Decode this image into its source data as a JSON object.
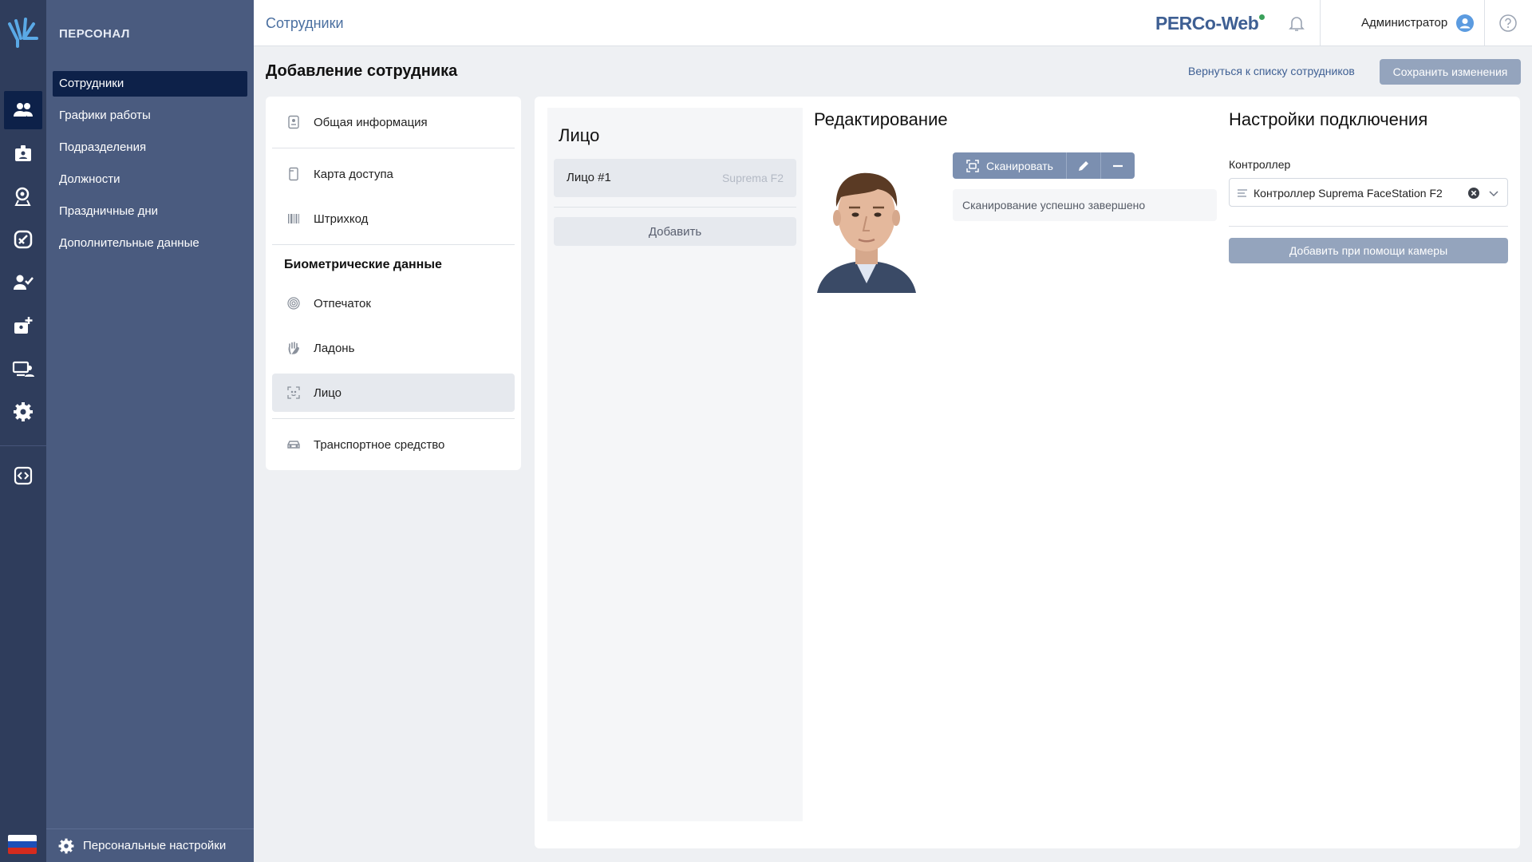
{
  "section": {
    "title": "ПЕРСОНАЛ",
    "items": [
      {
        "label": "Сотрудники",
        "active": true
      },
      {
        "label": "Графики работы"
      },
      {
        "label": "Подразделения"
      },
      {
        "label": "Должности"
      },
      {
        "label": "Праздничные дни"
      },
      {
        "label": "Дополнительные данные"
      }
    ],
    "footer_label": "Персональные настройки"
  },
  "topbar": {
    "breadcrumb": "Сотрудники",
    "brand": "PERCo-Web",
    "user": "Администратор"
  },
  "page": {
    "title": "Добавление сотрудника",
    "back_link": "Вернуться к списку сотрудников",
    "save_label": "Сохранить изменения"
  },
  "tabs": {
    "general": "Общая информация",
    "access_card": "Карта доступа",
    "barcode": "Штрихкод",
    "biometric_group": "Биометрические данные",
    "fingerprint": "Отпечаток",
    "palm": "Ладонь",
    "face": "Лицо",
    "vehicle": "Транспортное средство",
    "active": "face"
  },
  "faces": {
    "title": "Лицо",
    "items": [
      {
        "name": "Лицо #1",
        "device": "Suprema F2"
      }
    ],
    "add_label": "Добавить"
  },
  "editing": {
    "title": "Редактирование",
    "scan_label": "Сканировать",
    "status": "Сканирование успешно завершено"
  },
  "connection": {
    "title": "Настройки подключения",
    "controller_label": "Контроллер",
    "controller_value": "Контроллер Suprema FaceStation F2",
    "camera_button": "Добавить при помощи камеры"
  },
  "colors": {
    "rail_bg": "#2f3d5c",
    "section_bg": "#4a5b7f",
    "active_nav": "#0d2149",
    "brand": "#3e5f93",
    "button_disabled": "#94a4bd",
    "toolbar_button": "#7b8fb0"
  }
}
